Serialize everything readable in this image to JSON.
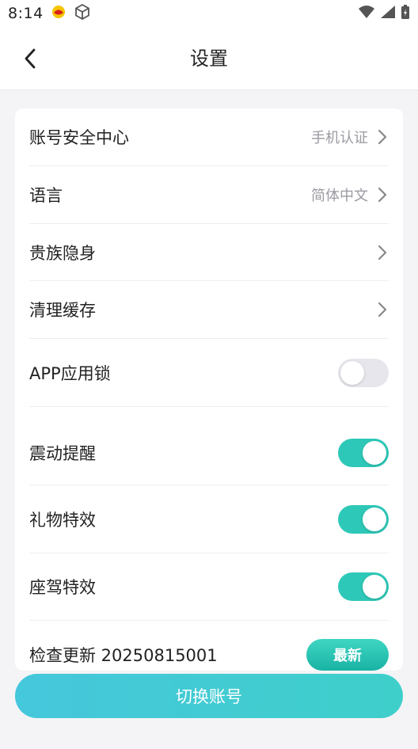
{
  "status_bar": {
    "time": "8:14",
    "left_icons": [
      "notification-app-icon",
      "cube-icon"
    ],
    "right_icons": [
      "wifi-icon",
      "signal-icon",
      "battery-charging-icon"
    ]
  },
  "header": {
    "title": "设置",
    "back_icon": "chevron-left-icon"
  },
  "settings": {
    "account_security": {
      "label": "账号安全中心",
      "value": "手机认证"
    },
    "language": {
      "label": "语言",
      "value": "简体中文"
    },
    "noble_stealth": {
      "label": "贵族隐身"
    },
    "clear_cache": {
      "label": "清理缓存"
    },
    "app_lock": {
      "label": "APP应用锁",
      "enabled": false
    },
    "vibration": {
      "label": "震动提醒",
      "enabled": true
    },
    "gift_effects": {
      "label": "礼物特效",
      "enabled": true
    },
    "mount_effects": {
      "label": "座驾特效",
      "enabled": true
    },
    "check_update": {
      "label": "检查更新 20250815001",
      "badge": "最新"
    }
  },
  "footer": {
    "switch_account_label": "切换账号"
  },
  "colors": {
    "accent": "#2ec8b8",
    "button_gradient_start": "#45c7dc",
    "button_gradient_end": "#3fcfca",
    "background": "#f4f4f6"
  }
}
